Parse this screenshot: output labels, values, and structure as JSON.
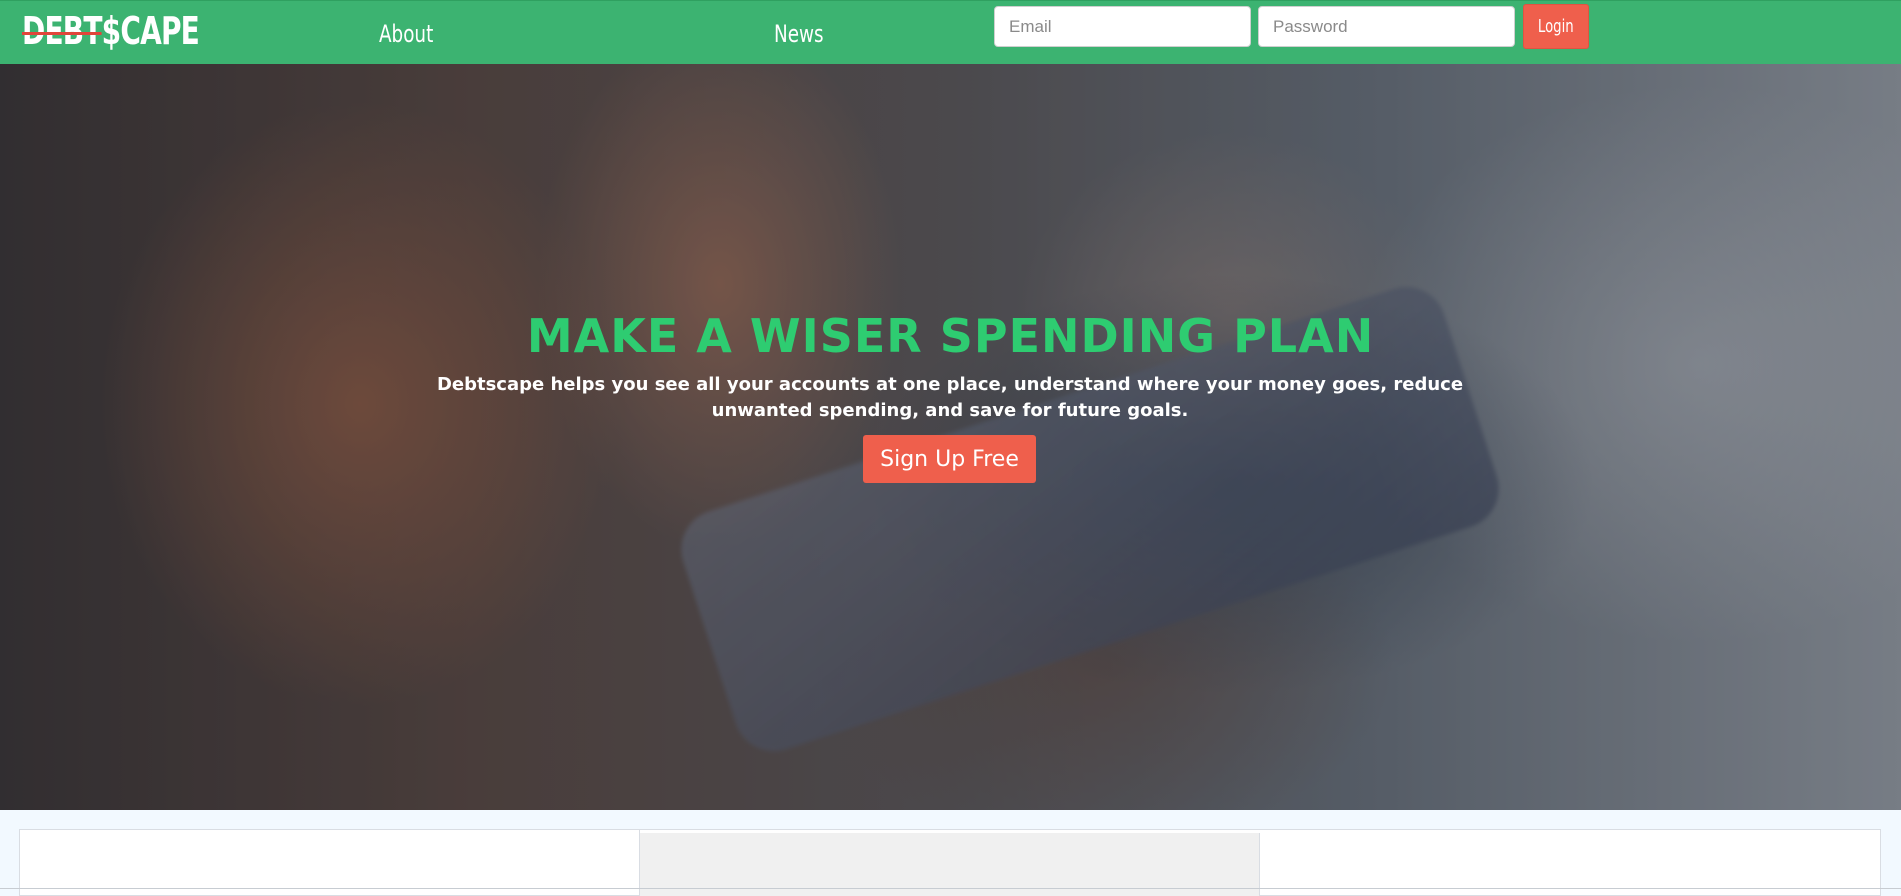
{
  "navbar": {
    "logo_text_strike": "DEBT",
    "logo_text_rest": "$CAPE",
    "links": [
      {
        "label": "About"
      },
      {
        "label": "News"
      }
    ],
    "email_placeholder": "Email",
    "password_placeholder": "Password",
    "login_label": "Login",
    "background_color": "#3cb371",
    "accent_color": "#ef5f4c"
  },
  "hero": {
    "title": "MAKE A WISER SPENDING PLAN",
    "subtitle": "Debtscape helps you see all your accounts at one place, understand where your money goes, reduce unwanted spending, and save for future goals.",
    "cta_label": "Sign Up Free",
    "title_color": "#2ecc71"
  }
}
